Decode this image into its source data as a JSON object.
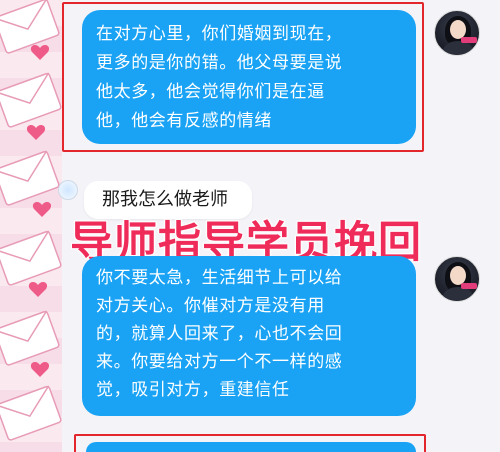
{
  "messages": [
    {
      "id": "m1",
      "sender": "mentor",
      "lines": [
        "在对方心里，你们婚姻到现在，",
        "更多的是你的错。他父母要是说",
        "他太多，他会觉得你们是在逼",
        "他，他会有反感的情绪"
      ]
    },
    {
      "id": "m2",
      "sender": "student",
      "text": "那我怎么做老师"
    },
    {
      "id": "m3",
      "sender": "mentor",
      "lines": [
        "你不要太急，生活细节上可以给",
        "对方关心。你催对方是没有用",
        "的，就算人回来了，心也不会回",
        "来。你要给对方一个不一样的感",
        "觉，吸引对方，重建信任"
      ]
    }
  ],
  "overlay_title": "导师指导学员挽回",
  "colors": {
    "bubble": "#1aa3f5",
    "highlight_border": "#e3262c",
    "title": "#ef2b5a"
  }
}
